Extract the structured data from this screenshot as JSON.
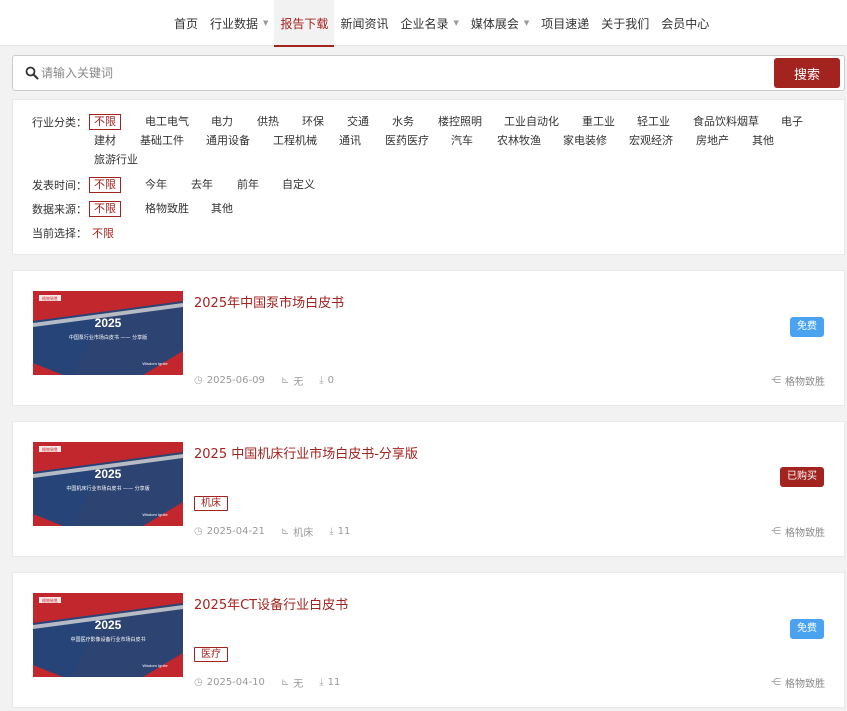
{
  "nav": {
    "items": [
      {
        "label": "首页",
        "caret": false,
        "active": false
      },
      {
        "label": "行业数据",
        "caret": true,
        "active": false
      },
      {
        "label": "报告下载",
        "caret": false,
        "active": true
      },
      {
        "label": "新闻资讯",
        "caret": false,
        "active": false
      },
      {
        "label": "企业名录",
        "caret": true,
        "active": false
      },
      {
        "label": "媒体展会",
        "caret": true,
        "active": false
      },
      {
        "label": "项目速递",
        "caret": false,
        "active": false
      },
      {
        "label": "关于我们",
        "caret": false,
        "active": false
      },
      {
        "label": "会员中心",
        "caret": false,
        "active": false
      }
    ]
  },
  "search": {
    "placeholder": "请输入关键词",
    "button_label": "搜索"
  },
  "filters": {
    "industry": {
      "label": "行业分类：",
      "options": [
        "不限",
        "电工电气",
        "电力",
        "供热",
        "环保",
        "交通",
        "水务",
        "楼控照明",
        "工业自动化",
        "重工业",
        "轻工业",
        "食品饮料烟草",
        "电子",
        "建材",
        "基础工件",
        "通用设备",
        "工程机械",
        "通讯",
        "医药医疗",
        "汽车",
        "农林牧渔",
        "家电装修",
        "宏观经济",
        "房地产",
        "其他",
        "旅游行业"
      ],
      "selected": "不限"
    },
    "time": {
      "label": "发表时间：",
      "options": [
        "不限",
        "今年",
        "去年",
        "前年",
        "自定义"
      ],
      "selected": "不限"
    },
    "source": {
      "label": "数据来源：",
      "options": [
        "不限",
        "格物致胜",
        "其他"
      ],
      "selected": "不限"
    },
    "current": {
      "label": "当前选择：",
      "value": "不限"
    }
  },
  "reports": [
    {
      "title": "2025年中国泵市场白皮书",
      "tag": "",
      "date": "2025-06-09",
      "category": "无",
      "downloads": "0",
      "badge": "免费",
      "badge_type": "free",
      "source": "格物致胜",
      "thumb_year": "2025",
      "thumb_caption": "中国泵行业市场白皮书 —— 分享版",
      "thumb_logo": "格物致胜",
      "thumb_brand": "Wisdom Ignite"
    },
    {
      "title": "2025 中国机床行业市场白皮书-分享版",
      "tag": "机床",
      "date": "2025-04-21",
      "category": "机床",
      "downloads": "11",
      "badge": "已购买",
      "badge_type": "bought",
      "source": "格物致胜",
      "thumb_year": "2025",
      "thumb_caption": "中国机床行业市场白皮书 —— 分享版",
      "thumb_logo": "格物致胜",
      "thumb_brand": "Wisdom Ignite"
    },
    {
      "title": "2025年CT设备行业白皮书",
      "tag": "医疗",
      "date": "2025-04-10",
      "category": "无",
      "downloads": "11",
      "badge": "免费",
      "badge_type": "free",
      "source": "格物致胜",
      "thumb_year": "2025",
      "thumb_caption": "中国医疗影像设备行业市场白皮书",
      "thumb_logo": "格物致胜",
      "thumb_brand": "Wisdom Ignite"
    }
  ],
  "colors": {
    "accent": "#a3231f",
    "free_badge": "#4aa3f0",
    "thumb_blue": "#1d3766",
    "thumb_red": "#c1272d"
  },
  "icons": {
    "search": "search-icon",
    "date": "clock-icon",
    "category": "chart-icon",
    "downloads": "download-icon",
    "source": "share-icon"
  }
}
